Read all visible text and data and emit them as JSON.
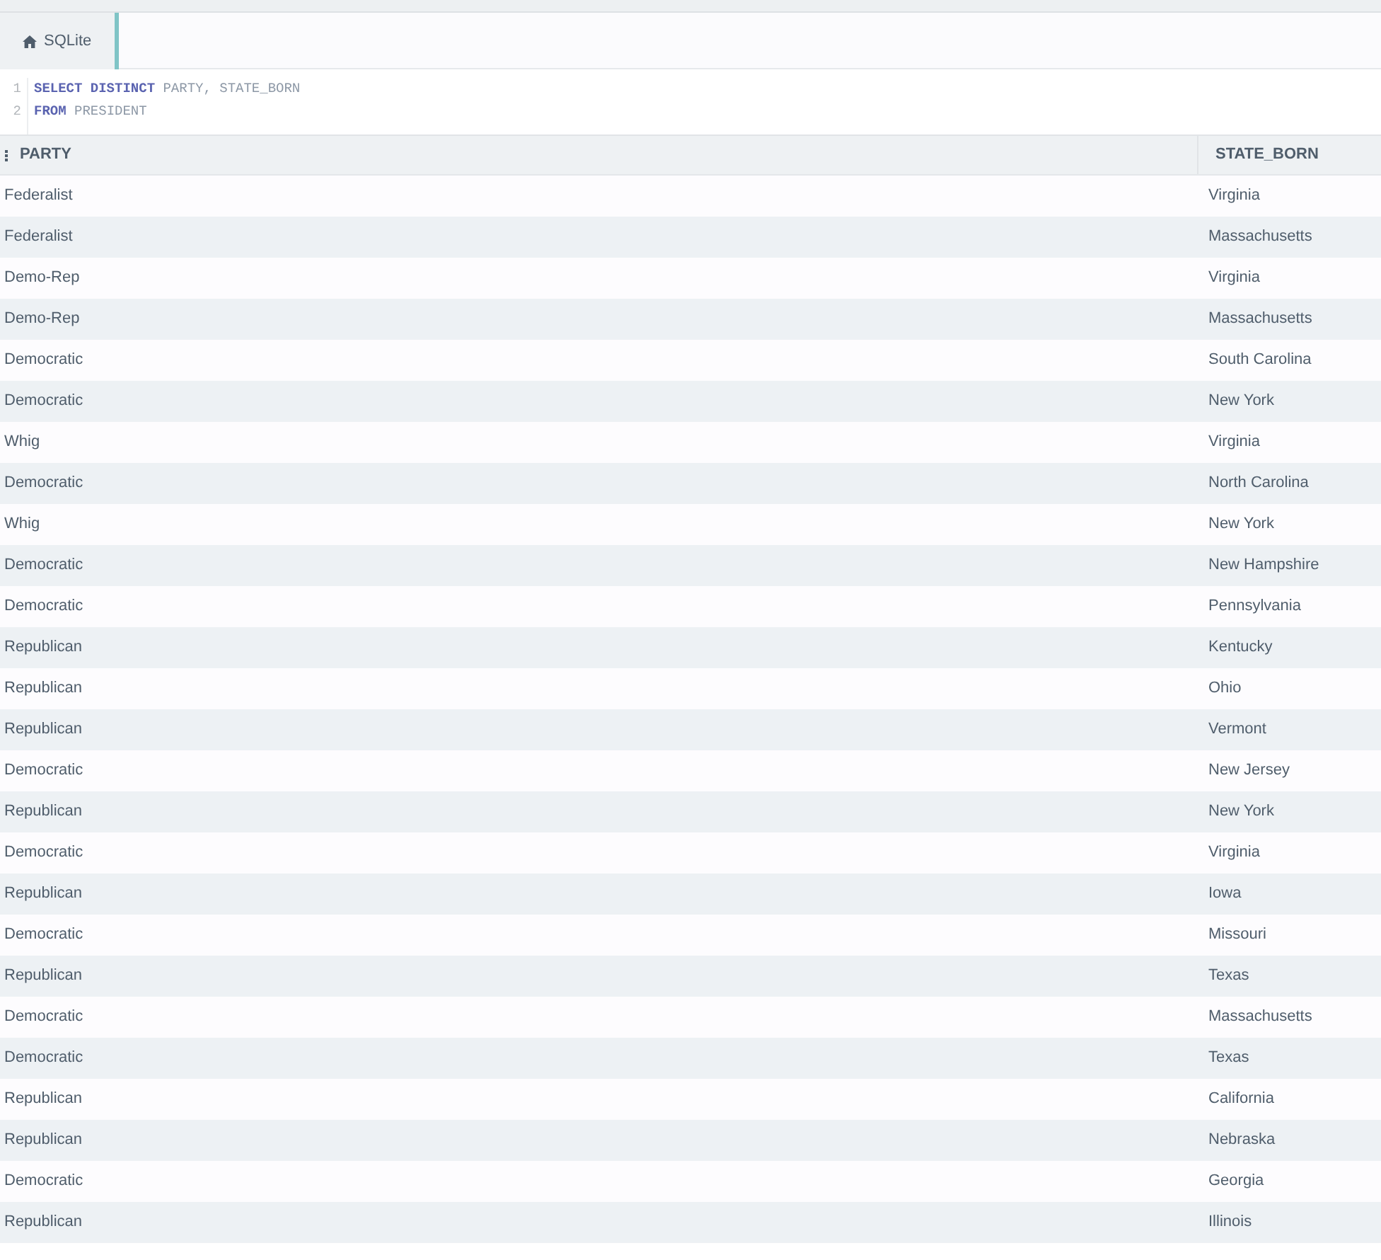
{
  "tab": {
    "label": "SQLite",
    "selected": true
  },
  "editor": {
    "lines": [
      {
        "number": "1",
        "tokens": [
          {
            "kind": "keyword",
            "text": "SELECT DISTINCT"
          },
          {
            "kind": "ident",
            "text": "PARTY, STATE_BORN"
          }
        ]
      },
      {
        "number": "2",
        "tokens": [
          {
            "kind": "keyword",
            "text": "FROM"
          },
          {
            "kind": "ident",
            "text": "PRESIDENT"
          }
        ]
      }
    ]
  },
  "table": {
    "columns": [
      "PARTY",
      "STATE_BORN"
    ],
    "rows": [
      [
        "Federalist",
        "Virginia"
      ],
      [
        "Federalist",
        "Massachusetts"
      ],
      [
        "Demo-Rep",
        "Virginia"
      ],
      [
        "Demo-Rep",
        "Massachusetts"
      ],
      [
        "Democratic",
        "South Carolina"
      ],
      [
        "Democratic",
        "New York"
      ],
      [
        "Whig",
        "Virginia"
      ],
      [
        "Democratic",
        "North Carolina"
      ],
      [
        "Whig",
        "New York"
      ],
      [
        "Democratic",
        "New Hampshire"
      ],
      [
        "Democratic",
        "Pennsylvania"
      ],
      [
        "Republican",
        "Kentucky"
      ],
      [
        "Republican",
        "Ohio"
      ],
      [
        "Republican",
        "Vermont"
      ],
      [
        "Democratic",
        "New Jersey"
      ],
      [
        "Republican",
        "New York"
      ],
      [
        "Democratic",
        "Virginia"
      ],
      [
        "Republican",
        "Iowa"
      ],
      [
        "Democratic",
        "Missouri"
      ],
      [
        "Republican",
        "Texas"
      ],
      [
        "Democratic",
        "Massachusetts"
      ],
      [
        "Democratic",
        "Texas"
      ],
      [
        "Republican",
        "California"
      ],
      [
        "Republican",
        "Nebraska"
      ],
      [
        "Democratic",
        "Georgia"
      ],
      [
        "Republican",
        "Illinois"
      ]
    ]
  }
}
